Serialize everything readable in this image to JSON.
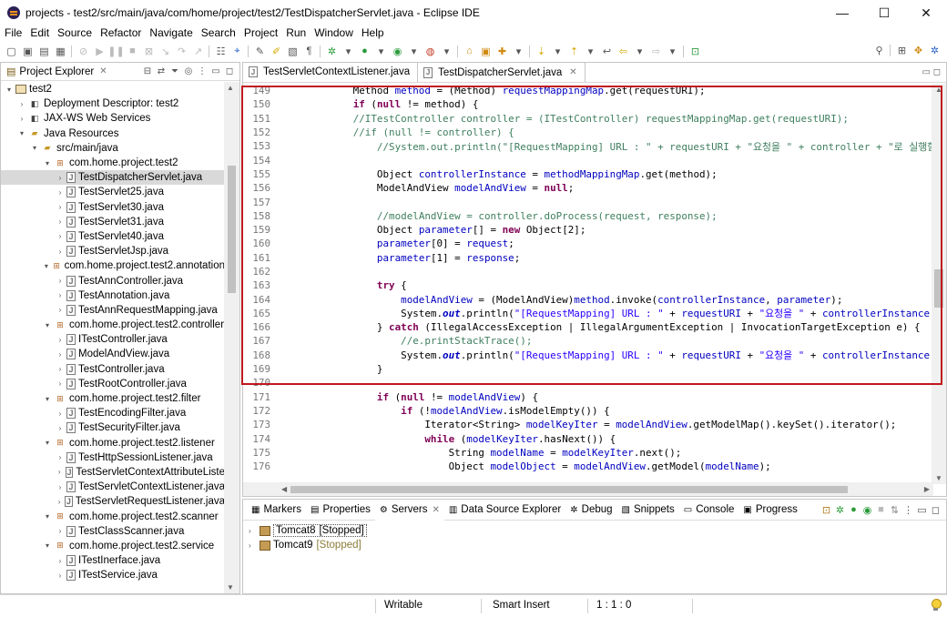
{
  "window": {
    "title": "projects - test2/src/main/java/com/home/project/test2/TestDispatcherServlet.java - Eclipse IDE",
    "minimize": "—",
    "maximize": "☐",
    "close": "✕"
  },
  "menu": [
    "File",
    "Edit",
    "Source",
    "Refactor",
    "Navigate",
    "Search",
    "Project",
    "Run",
    "Window",
    "Help"
  ],
  "explorer": {
    "tab_label": "Project Explorer",
    "tree": [
      {
        "label": "test2",
        "indent": 0,
        "twisty": "▾",
        "icon": "project"
      },
      {
        "label": "Deployment Descriptor: test2",
        "indent": 1,
        "twisty": "›",
        "icon": "misc"
      },
      {
        "label": "JAX-WS Web Services",
        "indent": 1,
        "twisty": "›",
        "icon": "misc"
      },
      {
        "label": "Java Resources",
        "indent": 1,
        "twisty": "▾",
        "icon": "folder"
      },
      {
        "label": "src/main/java",
        "indent": 2,
        "twisty": "▾",
        "icon": "folder"
      },
      {
        "label": "com.home.project.test2",
        "indent": 3,
        "twisty": "▾",
        "icon": "package"
      },
      {
        "label": "TestDispatcherServlet.java",
        "indent": 4,
        "twisty": "›",
        "icon": "java",
        "selected": true
      },
      {
        "label": "TestServlet25.java",
        "indent": 4,
        "twisty": "›",
        "icon": "java"
      },
      {
        "label": "TestServlet30.java",
        "indent": 4,
        "twisty": "›",
        "icon": "java"
      },
      {
        "label": "TestServlet31.java",
        "indent": 4,
        "twisty": "›",
        "icon": "java"
      },
      {
        "label": "TestServlet40.java",
        "indent": 4,
        "twisty": "›",
        "icon": "java"
      },
      {
        "label": "TestServletJsp.java",
        "indent": 4,
        "twisty": "›",
        "icon": "java"
      },
      {
        "label": "com.home.project.test2.annotation",
        "indent": 3,
        "twisty": "▾",
        "icon": "package"
      },
      {
        "label": "TestAnnController.java",
        "indent": 4,
        "twisty": "›",
        "icon": "java"
      },
      {
        "label": "TestAnnotation.java",
        "indent": 4,
        "twisty": "›",
        "icon": "java"
      },
      {
        "label": "TestAnnRequestMapping.java",
        "indent": 4,
        "twisty": "›",
        "icon": "java"
      },
      {
        "label": "com.home.project.test2.controller",
        "indent": 3,
        "twisty": "▾",
        "icon": "package"
      },
      {
        "label": "ITestController.java",
        "indent": 4,
        "twisty": "›",
        "icon": "java"
      },
      {
        "label": "ModelAndView.java",
        "indent": 4,
        "twisty": "›",
        "icon": "java"
      },
      {
        "label": "TestController.java",
        "indent": 4,
        "twisty": "›",
        "icon": "java"
      },
      {
        "label": "TestRootController.java",
        "indent": 4,
        "twisty": "›",
        "icon": "java"
      },
      {
        "label": "com.home.project.test2.filter",
        "indent": 3,
        "twisty": "▾",
        "icon": "package"
      },
      {
        "label": "TestEncodingFilter.java",
        "indent": 4,
        "twisty": "›",
        "icon": "java"
      },
      {
        "label": "TestSecurityFilter.java",
        "indent": 4,
        "twisty": "›",
        "icon": "java"
      },
      {
        "label": "com.home.project.test2.listener",
        "indent": 3,
        "twisty": "▾",
        "icon": "package"
      },
      {
        "label": "TestHttpSessionListener.java",
        "indent": 4,
        "twisty": "›",
        "icon": "java"
      },
      {
        "label": "TestServletContextAttributeListe",
        "indent": 4,
        "twisty": "›",
        "icon": "java"
      },
      {
        "label": "TestServletContextListener.java",
        "indent": 4,
        "twisty": "›",
        "icon": "java"
      },
      {
        "label": "TestServletRequestListener.java",
        "indent": 4,
        "twisty": "›",
        "icon": "java"
      },
      {
        "label": "com.home.project.test2.scanner",
        "indent": 3,
        "twisty": "▾",
        "icon": "package"
      },
      {
        "label": "TestClassScanner.java",
        "indent": 4,
        "twisty": "›",
        "icon": "java"
      },
      {
        "label": "com.home.project.test2.service",
        "indent": 3,
        "twisty": "▾",
        "icon": "package"
      },
      {
        "label": "ITestInerface.java",
        "indent": 4,
        "twisty": "›",
        "icon": "java"
      },
      {
        "label": "ITestService.java",
        "indent": 4,
        "twisty": "›",
        "icon": "java"
      }
    ]
  },
  "editor": {
    "tabs": [
      {
        "label": "TestServletContextListener.java",
        "active": false
      },
      {
        "label": "TestDispatcherServlet.java",
        "active": true
      }
    ],
    "lines": [
      {
        "n": "149",
        "tokens": [
          [
            "p",
            "            Method "
          ],
          [
            "f",
            "method"
          ],
          [
            "p",
            " = (Method) "
          ],
          [
            "f",
            "requestMappingMap"
          ],
          [
            "p",
            ".get(requestURI);"
          ]
        ]
      },
      {
        "n": "150",
        "tokens": [
          [
            "p",
            "            "
          ],
          [
            "k",
            "if"
          ],
          [
            "p",
            " ("
          ],
          [
            "k",
            "null"
          ],
          [
            "p",
            " != method) {"
          ]
        ]
      },
      {
        "n": "151",
        "tokens": [
          [
            "p",
            "            "
          ],
          [
            "c",
            "//ITestController controller = (ITestController) requestMappingMap.get(requestURI);"
          ]
        ]
      },
      {
        "n": "152",
        "tokens": [
          [
            "p",
            "            "
          ],
          [
            "c",
            "//if (null != controller) {"
          ]
        ]
      },
      {
        "n": "153",
        "tokens": [
          [
            "p",
            "                "
          ],
          [
            "c",
            "//System.out.println(\"[RequestMapping] URL : \" + requestURI + \"요청을 \" + controller + \"로 실행함"
          ]
        ]
      },
      {
        "n": "154",
        "tokens": [
          [
            "p",
            ""
          ]
        ]
      },
      {
        "n": "155",
        "tokens": [
          [
            "p",
            "                Object "
          ],
          [
            "f",
            "controllerInstance"
          ],
          [
            "p",
            " = "
          ],
          [
            "f",
            "methodMappingMap"
          ],
          [
            "p",
            ".get(method);"
          ]
        ]
      },
      {
        "n": "156",
        "tokens": [
          [
            "p",
            "                ModelAndView "
          ],
          [
            "f",
            "modelAndView"
          ],
          [
            "p",
            " = "
          ],
          [
            "k",
            "null"
          ],
          [
            "p",
            ";"
          ]
        ]
      },
      {
        "n": "157",
        "tokens": [
          [
            "p",
            ""
          ]
        ]
      },
      {
        "n": "158",
        "tokens": [
          [
            "p",
            "                "
          ],
          [
            "c",
            "//modelAndView = controller.doProcess(request, response);"
          ]
        ]
      },
      {
        "n": "159",
        "tokens": [
          [
            "p",
            "                Object "
          ],
          [
            "f",
            "parameter"
          ],
          [
            "p",
            "[] = "
          ],
          [
            "k",
            "new"
          ],
          [
            "p",
            " Object[2];"
          ]
        ]
      },
      {
        "n": "160",
        "tokens": [
          [
            "p",
            "                "
          ],
          [
            "f",
            "parameter"
          ],
          [
            "p",
            "[0] = "
          ],
          [
            "f",
            "request"
          ],
          [
            "p",
            ";"
          ]
        ]
      },
      {
        "n": "161",
        "tokens": [
          [
            "p",
            "                "
          ],
          [
            "f",
            "parameter"
          ],
          [
            "p",
            "[1] = "
          ],
          [
            "f",
            "response"
          ],
          [
            "p",
            ";"
          ]
        ]
      },
      {
        "n": "162",
        "tokens": [
          [
            "p",
            ""
          ]
        ]
      },
      {
        "n": "163",
        "tokens": [
          [
            "p",
            "                "
          ],
          [
            "k",
            "try"
          ],
          [
            "p",
            " {"
          ]
        ]
      },
      {
        "n": "164",
        "tokens": [
          [
            "p",
            "                    "
          ],
          [
            "f",
            "modelAndView"
          ],
          [
            "p",
            " = (ModelAndView)"
          ],
          [
            "f",
            "method"
          ],
          [
            "p",
            ".invoke("
          ],
          [
            "f",
            "controllerInstance"
          ],
          [
            "p",
            ", "
          ],
          [
            "f",
            "parameter"
          ],
          [
            "p",
            ");"
          ]
        ]
      },
      {
        "n": "165",
        "tokens": [
          [
            "p",
            "                    System."
          ],
          [
            "i",
            "out"
          ],
          [
            "p",
            ".println("
          ],
          [
            "s",
            "\"[RequestMapping] URL : \""
          ],
          [
            "p",
            " + "
          ],
          [
            "f",
            "requestURI"
          ],
          [
            "p",
            " + "
          ],
          [
            "s",
            "\"요청을 \""
          ],
          [
            "p",
            " + "
          ],
          [
            "f",
            "controllerInstance"
          ]
        ]
      },
      {
        "n": "166",
        "tokens": [
          [
            "p",
            "                } "
          ],
          [
            "k",
            "catch"
          ],
          [
            "p",
            " (IllegalAccessException | IllegalArgumentException | InvocationTargetException e) {"
          ]
        ]
      },
      {
        "n": "167",
        "tokens": [
          [
            "p",
            "                    "
          ],
          [
            "c",
            "//e.printStackTrace();"
          ]
        ]
      },
      {
        "n": "168",
        "tokens": [
          [
            "p",
            "                    System."
          ],
          [
            "i",
            "out"
          ],
          [
            "p",
            ".println("
          ],
          [
            "s",
            "\"[RequestMapping] URL : \""
          ],
          [
            "p",
            " + "
          ],
          [
            "f",
            "requestURI"
          ],
          [
            "p",
            " + "
          ],
          [
            "s",
            "\"요청을 \""
          ],
          [
            "p",
            " + "
          ],
          [
            "f",
            "controllerInstance"
          ]
        ]
      },
      {
        "n": "169",
        "tokens": [
          [
            "p",
            "                }"
          ]
        ]
      },
      {
        "n": "170",
        "tokens": [
          [
            "p",
            ""
          ]
        ]
      },
      {
        "n": "171",
        "tokens": [
          [
            "p",
            "                "
          ],
          [
            "k",
            "if"
          ],
          [
            "p",
            " ("
          ],
          [
            "k",
            "null"
          ],
          [
            "p",
            " != "
          ],
          [
            "f",
            "modelAndView"
          ],
          [
            "p",
            ") {"
          ]
        ]
      },
      {
        "n": "172",
        "tokens": [
          [
            "p",
            "                    "
          ],
          [
            "k",
            "if"
          ],
          [
            "p",
            " (!"
          ],
          [
            "f",
            "modelAndView"
          ],
          [
            "p",
            ".isModelEmpty()) {"
          ]
        ]
      },
      {
        "n": "173",
        "tokens": [
          [
            "p",
            "                        Iterator<String> "
          ],
          [
            "f",
            "modelKeyIter"
          ],
          [
            "p",
            " = "
          ],
          [
            "f",
            "modelAndView"
          ],
          [
            "p",
            ".getModelMap().keySet().iterator();"
          ]
        ]
      },
      {
        "n": "174",
        "tokens": [
          [
            "p",
            "                        "
          ],
          [
            "k",
            "while"
          ],
          [
            "p",
            " ("
          ],
          [
            "f",
            "modelKeyIter"
          ],
          [
            "p",
            ".hasNext()) {"
          ]
        ]
      },
      {
        "n": "175",
        "tokens": [
          [
            "p",
            "                            String "
          ],
          [
            "f",
            "modelName"
          ],
          [
            "p",
            " = "
          ],
          [
            "f",
            "modelKeyIter"
          ],
          [
            "p",
            ".next();"
          ]
        ]
      },
      {
        "n": "176",
        "tokens": [
          [
            "p",
            "                            Object "
          ],
          [
            "f",
            "modelObject"
          ],
          [
            "p",
            " = "
          ],
          [
            "f",
            "modelAndView"
          ],
          [
            "p",
            ".getModel("
          ],
          [
            "f",
            "modelName"
          ],
          [
            "p",
            ");"
          ]
        ]
      }
    ]
  },
  "bottom": {
    "tabs": [
      {
        "label": "Markers",
        "icon": "▦"
      },
      {
        "label": "Properties",
        "icon": "▤"
      },
      {
        "label": "Servers",
        "icon": "⚙",
        "active": true
      },
      {
        "label": "Data Source Explorer",
        "icon": "▥"
      },
      {
        "label": "Debug",
        "icon": "✲"
      },
      {
        "label": "Snippets",
        "icon": "▧"
      },
      {
        "label": "Console",
        "icon": "▭"
      },
      {
        "label": "Progress",
        "icon": "▣"
      }
    ],
    "servers": [
      {
        "name": "Tomcat8",
        "status": "[Stopped]",
        "selected": true
      },
      {
        "name": "Tomcat9",
        "status": "[Stopped]",
        "selected": false
      }
    ]
  },
  "status": {
    "mode": "Writable",
    "insert": "Smart Insert",
    "position": "1 : 1 : 0"
  },
  "colors": {
    "keyword": "#7f0055",
    "comment": "#3f7f5f",
    "string": "#2a00ff",
    "field": "#0000c0",
    "highlight_box": "#c0181e"
  }
}
